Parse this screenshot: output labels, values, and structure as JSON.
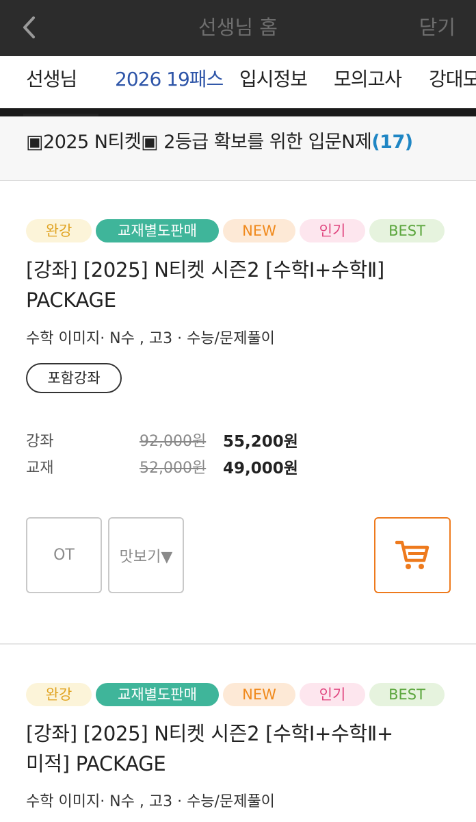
{
  "topbar": {
    "title": "선생님 홈",
    "close_label": "닫기"
  },
  "tabs": [
    {
      "label": "선생님"
    },
    {
      "label": "2026 19패스"
    },
    {
      "label": "입시정보"
    },
    {
      "label": "모의고사"
    },
    {
      "label": "강대모"
    }
  ],
  "notice": {
    "text": "▣2025 N티켓▣ 2등급 확보를 위한 입문N제",
    "count": "(17)"
  },
  "courses": [
    {
      "badges": [
        "완강",
        "교재별도판매",
        "NEW",
        "인기",
        "BEST"
      ],
      "title_line1": "[강좌] [2025] N티켓 시즌2 [수학Ⅰ+수학Ⅱ]",
      "title_line2": "PACKAGE",
      "meta": "수학 이미지· N수 , 고3 · 수능/문제풀이",
      "include_label": "포함강좌",
      "prices": [
        {
          "label": "강좌",
          "original": "92,000원",
          "sale": "55,200원"
        },
        {
          "label": "교재",
          "original": "52,000원",
          "sale": "49,000원"
        }
      ],
      "ot_label": "OT",
      "preview_label": "맛보기▼"
    },
    {
      "badges": [
        "완강",
        "교재별도판매",
        "NEW",
        "인기",
        "BEST"
      ],
      "title_line1": "[강좌] [2025] N티켓 시즌2 [수학Ⅰ+수학Ⅱ+",
      "title_line2": "미적] PACKAGE",
      "meta": "수학 이미지· N수 , 고3 · 수능/문제풀이"
    }
  ],
  "colors": {
    "accent_blue": "#2e55a8",
    "count_blue": "#1f86c4",
    "cart_orange": "#ee7a1d",
    "badge_green": "#3fb59a"
  },
  "icons": {
    "back": "chevron-left-icon",
    "cart": "cart-icon"
  }
}
